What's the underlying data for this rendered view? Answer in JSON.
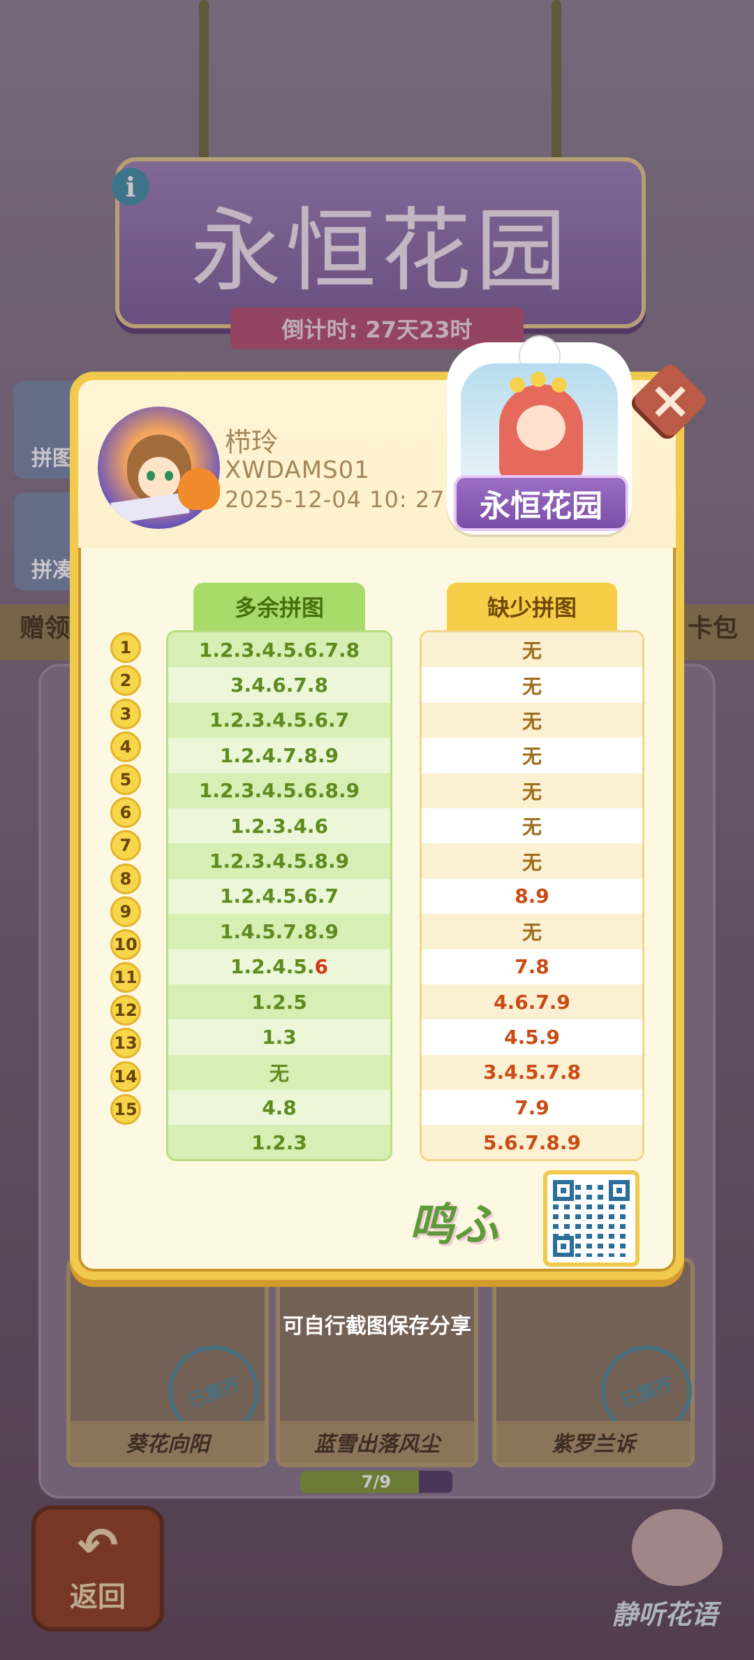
{
  "background": {
    "banner_title": "永恒花园",
    "countdown": "倒计时: 27天23时",
    "side_buttons": [
      "拼图",
      "拼凑"
    ],
    "strip_left": "赠领",
    "strip_right": "卡包",
    "cards": [
      "葵花向阳",
      "蓝雪出落风尘",
      "紫罗兰诉"
    ],
    "stamp_text": "已集齐",
    "progress": {
      "label": "7/9",
      "fraction": 0.7778
    },
    "back_button": "返回",
    "listen_button": "静听花语"
  },
  "player": {
    "name": "栉玲",
    "id": "XWDAMS01",
    "datetime": "2025-12-04 10: 27"
  },
  "badge": {
    "title": "永恒花园"
  },
  "table": {
    "extra_header": "多余拼图",
    "missing_header": "缺少拼图",
    "rows": [
      {
        "n": "1",
        "extra": "1.2.3.4.5.6.7.8",
        "missing": "无"
      },
      {
        "n": "2",
        "extra": "3.4.6.7.8",
        "missing": "无"
      },
      {
        "n": "3",
        "extra": "1.2.3.4.5.6.7",
        "missing": "无"
      },
      {
        "n": "4",
        "extra": "1.2.4.7.8.9",
        "missing": "无"
      },
      {
        "n": "5",
        "extra": "1.2.3.4.5.6.8.9",
        "missing": "无"
      },
      {
        "n": "6",
        "extra": "1.2.3.4.6",
        "missing": "无"
      },
      {
        "n": "7",
        "extra": "1.2.3.4.5.8.9",
        "missing": "无"
      },
      {
        "n": "8",
        "extra": "1.2.4.5.6.7",
        "missing": "8.9"
      },
      {
        "n": "9",
        "extra": "1.4.5.7.8.9",
        "missing": "无"
      },
      {
        "n": "10",
        "extra": "1.2.4.5.",
        "extra_red": "6",
        "missing": "7.8"
      },
      {
        "n": "11",
        "extra": "1.2.5",
        "missing": "4.6.7.9"
      },
      {
        "n": "12",
        "extra": "1.3",
        "missing": "4.5.9"
      },
      {
        "n": "13",
        "extra": "无",
        "missing": "3.4.5.7.8"
      },
      {
        "n": "14",
        "extra": "4.8",
        "missing": "7.9"
      },
      {
        "n": "15",
        "extra": "1.2.3",
        "missing": "5.6.7.8.9"
      }
    ]
  },
  "hint": "可自行截图保存分享",
  "colors": {
    "modal_border": "#f1c94d",
    "extra_header": "#a9db6a",
    "missing_header": "#f7ce48",
    "close_button": "#b95b46"
  }
}
